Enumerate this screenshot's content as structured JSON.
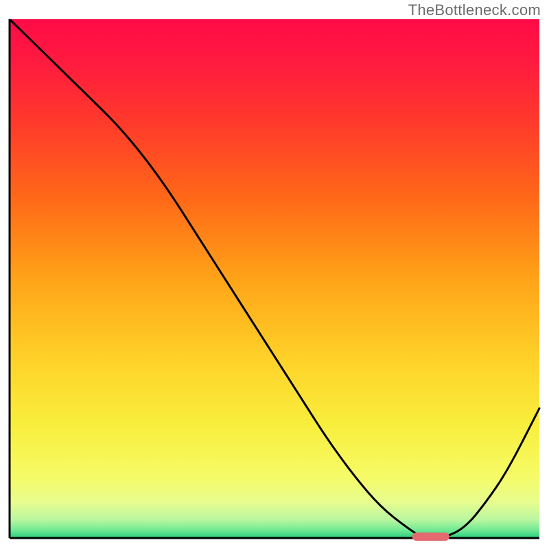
{
  "watermark": "TheBottleneck.com",
  "chart_data": {
    "type": "line",
    "title": "",
    "xlabel": "",
    "ylabel": "",
    "xlim": [
      0,
      100
    ],
    "ylim": [
      0,
      100
    ],
    "x": [
      0,
      5,
      10,
      15,
      20,
      25,
      30,
      35,
      40,
      45,
      50,
      55,
      60,
      65,
      70,
      75,
      78,
      82,
      86,
      90,
      94,
      100
    ],
    "y": [
      100,
      95,
      90,
      85,
      80,
      74,
      67,
      59,
      51,
      43,
      35,
      27,
      19,
      12,
      6,
      2,
      0,
      0,
      2,
      7,
      13,
      25
    ],
    "optimum_marker": {
      "x_start": 76,
      "x_end": 83,
      "y": 0
    },
    "gradient_stops": [
      {
        "offset": 0.0,
        "color": "#ff0b47"
      },
      {
        "offset": 0.08,
        "color": "#ff1a3f"
      },
      {
        "offset": 0.2,
        "color": "#ff3a2b"
      },
      {
        "offset": 0.35,
        "color": "#ff6a18"
      },
      {
        "offset": 0.5,
        "color": "#ffa318"
      },
      {
        "offset": 0.65,
        "color": "#ffd028"
      },
      {
        "offset": 0.78,
        "color": "#f8ee3c"
      },
      {
        "offset": 0.88,
        "color": "#f6fb66"
      },
      {
        "offset": 0.93,
        "color": "#e8fd8e"
      },
      {
        "offset": 0.965,
        "color": "#b9f6a0"
      },
      {
        "offset": 0.985,
        "color": "#70e893"
      },
      {
        "offset": 1.0,
        "color": "#25d07d"
      }
    ],
    "marker_color": "#e46a6f",
    "line_color": "#000000",
    "axis_color": "#000000"
  }
}
